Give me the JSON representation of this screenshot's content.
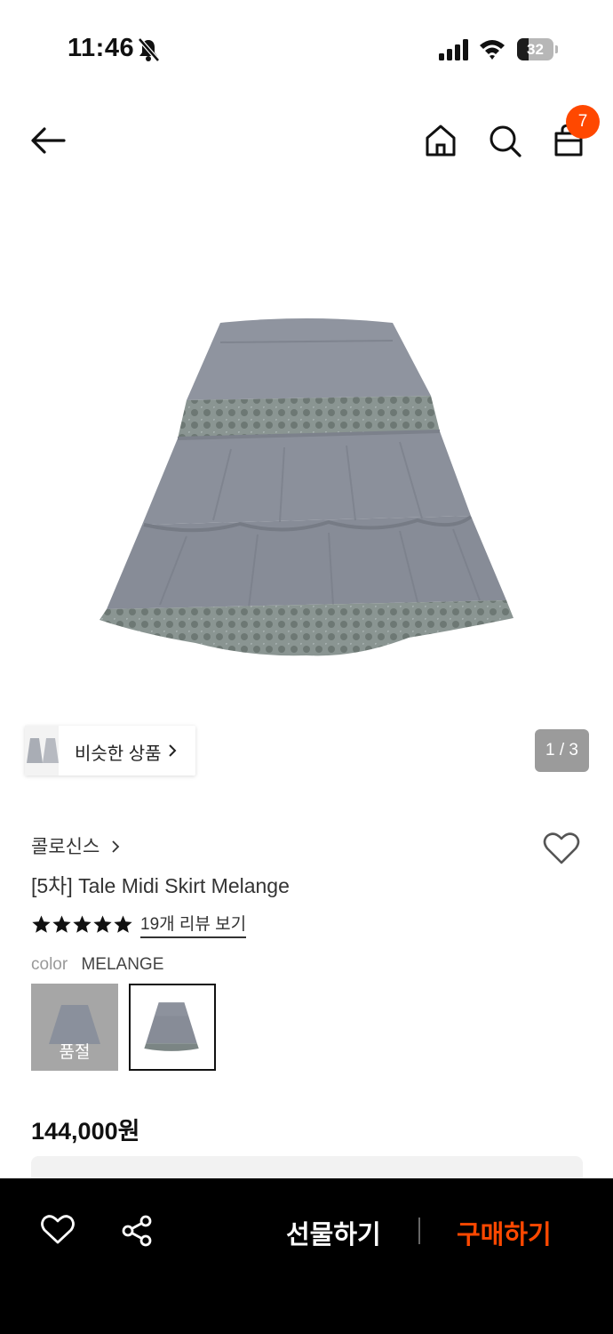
{
  "status_bar": {
    "time": "11:46",
    "battery": "32",
    "battery_level": 0.32
  },
  "nav": {
    "cart_count": "7",
    "icons": [
      "back-arrow-icon",
      "home-icon",
      "search-icon",
      "shopping-bag-icon"
    ]
  },
  "gallery": {
    "similar_label": "비슷한 상품",
    "counter": "1 / 3"
  },
  "product": {
    "brand": "콜로신스",
    "name": "[5차] Tale Midi Skirt Melange",
    "rating_stars": 5,
    "review_link": "19개 리뷰 보기",
    "color_label": "color",
    "color_value": "MELANGE",
    "soldout_label": "품절",
    "price": "144,000원"
  },
  "bottom_bar": {
    "gift_label": "선물하기",
    "buy_label": "구매하기"
  },
  "colors": {
    "accent": "#ff4800",
    "bottom_bar_bg": "#000000",
    "skirt": "#8d929c",
    "lace": "#7f8a88"
  }
}
